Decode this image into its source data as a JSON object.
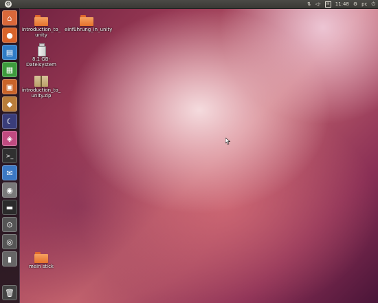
{
  "panel": {
    "indicators": [
      "⇅",
      "◁-",
      "✉",
      "11:48",
      "⚙",
      "pc",
      "⏻"
    ]
  },
  "launcher": {
    "items": [
      {
        "name": "dash-home",
        "glyph": "⌂",
        "color": "#d9683a"
      },
      {
        "name": "firefox",
        "glyph": "●",
        "color": "#d8632a"
      },
      {
        "name": "libreoffice-writer",
        "glyph": "▤",
        "color": "#2f7cc6"
      },
      {
        "name": "libreoffice-calc",
        "glyph": "▦",
        "color": "#3d9b3d"
      },
      {
        "name": "libreoffice-impress",
        "glyph": "▣",
        "color": "#c9642a"
      },
      {
        "name": "software-center",
        "glyph": "◆",
        "color": "#b97d3a"
      },
      {
        "name": "screen-saver",
        "glyph": "☾",
        "color": "#3a3d7a"
      },
      {
        "name": "app-installer",
        "glyph": "◈",
        "color": "#c04a80"
      },
      {
        "name": "terminal",
        "glyph": ">_",
        "color": "#303030"
      },
      {
        "name": "thunderbird",
        "glyph": "✉",
        "color": "#3b78c4"
      },
      {
        "name": "screenshot-tool",
        "glyph": "◉",
        "color": "#7a7a7a"
      },
      {
        "name": "system-monitor",
        "glyph": "▬",
        "color": "#2b2b2b"
      },
      {
        "name": "workspace-switcher",
        "glyph": "⊙",
        "color": "#555555"
      },
      {
        "name": "search-files",
        "glyph": "◎",
        "color": "#555555"
      },
      {
        "name": "usb-drive",
        "glyph": "▮",
        "color": "#666666"
      },
      {
        "name": "trash",
        "glyph": "🗑",
        "color": "#444444"
      }
    ]
  },
  "desktop": {
    "icons": [
      {
        "name": "folder-introduction-to-unity",
        "type": "folder",
        "label": "introduction_to_\nunity"
      },
      {
        "name": "folder-einfuehrung-in-unity",
        "type": "folder",
        "label": "einführung_in_unity"
      },
      {
        "name": "drive-8gb",
        "type": "usb",
        "label": "8,1 GB-Dateisystem"
      },
      {
        "name": "zip-introduction-to-unity",
        "type": "zip",
        "label": "introduction_to_\nunity.zip"
      },
      {
        "name": "folder-mein-stick",
        "type": "folder",
        "label": "mein stick"
      }
    ]
  }
}
